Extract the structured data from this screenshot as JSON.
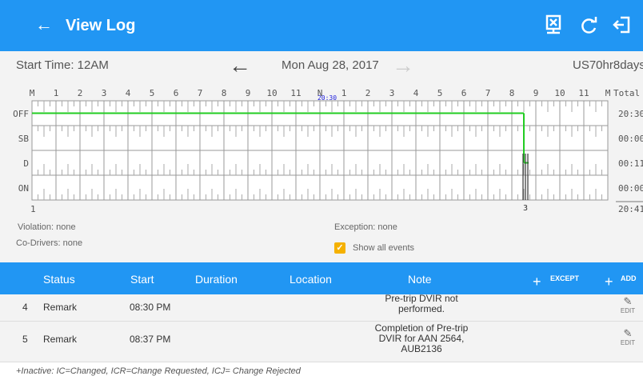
{
  "appbar": {
    "back_icon": "arrow-left-icon",
    "title": "View Log",
    "actions": [
      "transfer-log-icon",
      "refresh-icon",
      "logout-icon"
    ]
  },
  "daterow": {
    "start_time": "Start Time: 12AM",
    "date": "Mon Aug 28, 2017",
    "cycle": "US70hr8days"
  },
  "grid": {
    "hour_labels": [
      "M",
      "1",
      "2",
      "3",
      "4",
      "5",
      "6",
      "7",
      "8",
      "9",
      "10",
      "11",
      "N",
      "1",
      "2",
      "3",
      "4",
      "5",
      "6",
      "7",
      "8",
      "9",
      "10",
      "11",
      "M"
    ],
    "total_header": "Total",
    "rows": [
      {
        "label": "OFF",
        "total": "20:30"
      },
      {
        "label": "SB",
        "total": "00:00"
      },
      {
        "label": "D",
        "total": "00:11"
      },
      {
        "label": "ON",
        "total": "00:00"
      }
    ],
    "grand_total": "20:41",
    "off_duration_label": "20:30",
    "bottom_left_label": "1",
    "event_marker_label": "3",
    "duty_events": [
      {
        "status": "OFF",
        "start_hour": 0,
        "end_hour": 20.5
      },
      {
        "status": "D",
        "start_hour": 20.5,
        "end_hour": 20.7
      }
    ],
    "colors": {
      "duty_line": "#22cc22",
      "off_label": "#2222dd"
    }
  },
  "info": {
    "violation": "Violation: none",
    "co_drivers": "Co-Drivers: none",
    "exception": "Exception: none",
    "show_all_events": "Show all events",
    "show_all_checked": true
  },
  "table": {
    "headers": {
      "status": "Status",
      "start": "Start",
      "duration": "Duration",
      "location": "Location",
      "note": "Note",
      "except": "EXCEPT",
      "add": "ADD"
    },
    "rows": [
      {
        "num": "4",
        "status": "Remark",
        "start": "08:30 PM",
        "duration": "",
        "location": "",
        "note_lines": [
          "Pre-trip DVIR not",
          "performed."
        ],
        "edit": "EDIT"
      },
      {
        "num": "5",
        "status": "Remark",
        "start": "08:37 PM",
        "duration": "",
        "location": "",
        "note_lines": [
          "Completion of Pre-trip",
          "DVIR for AAN 2564,",
          "AUB2136"
        ],
        "edit": "EDIT"
      }
    ]
  },
  "footnote": "+Inactive: IC=Changed, ICR=Change Requested, ICJ= Change Rejected",
  "colors": {
    "primary": "#2196f3",
    "checkbox": "#f5b100"
  }
}
